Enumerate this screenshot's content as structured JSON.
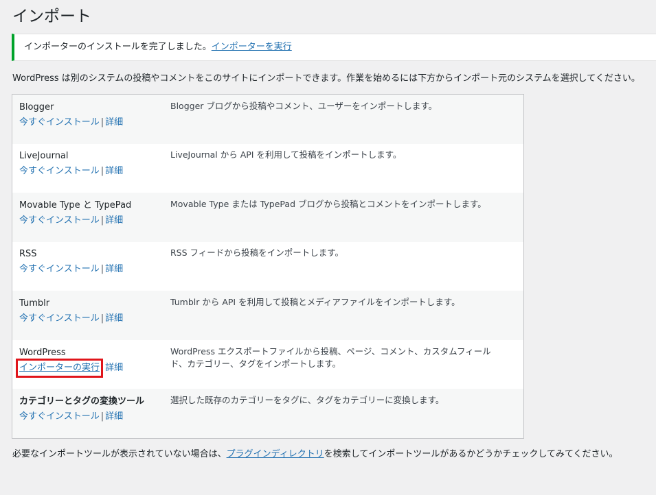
{
  "page": {
    "title": "インポート"
  },
  "notice": {
    "text": "インポーターのインストールを完了しました。",
    "link": "インポーターを実行"
  },
  "intro": "WordPress は別のシステムの投稿やコメントをこのサイトにインポートできます。作業を始めるには下方からインポート元のシステムを選択してください。",
  "separator": "|",
  "importers": [
    {
      "name": "Blogger",
      "action": "今すぐインストール",
      "details": "詳細",
      "description": "Blogger ブログから投稿やコメント、ユーザーをインポートします。"
    },
    {
      "name": "LiveJournal",
      "action": "今すぐインストール",
      "details": "詳細",
      "description": "LiveJournal から API を利用して投稿をインポートします。"
    },
    {
      "name": "Movable Type と TypePad",
      "action": "今すぐインストール",
      "details": "詳細",
      "description": "Movable Type または TypePad ブログから投稿とコメントをインポートします。"
    },
    {
      "name": "RSS",
      "action": "今すぐインストール",
      "details": "詳細",
      "description": "RSS フィードから投稿をインポートします。"
    },
    {
      "name": "Tumblr",
      "action": "今すぐインストール",
      "details": "詳細",
      "description": "Tumblr から API を利用して投稿とメディアファイルをインポートします。"
    },
    {
      "name": "WordPress",
      "action": "インポーターの実行",
      "details": "詳細",
      "description": "WordPress エクスポートファイルから投稿、ページ、コメント、カスタムフィールド、カテゴリー、タグをインポートします。"
    },
    {
      "name": "カテゴリーとタグの変換ツール",
      "action": "今すぐインストール",
      "details": "詳細",
      "description": "選択した既存のカテゴリーをタグに、タグをカテゴリーに変換します。"
    }
  ],
  "footer": {
    "prefix": "必要なインポートツールが表示されていない場合は、",
    "link": "プラグインディレクトリ",
    "suffix": "を検索してインポートツールがあるかどうかチェックしてみてください。"
  },
  "colors": {
    "link": "#2271b1",
    "success": "#00a32a",
    "highlight": "#e0151b"
  }
}
